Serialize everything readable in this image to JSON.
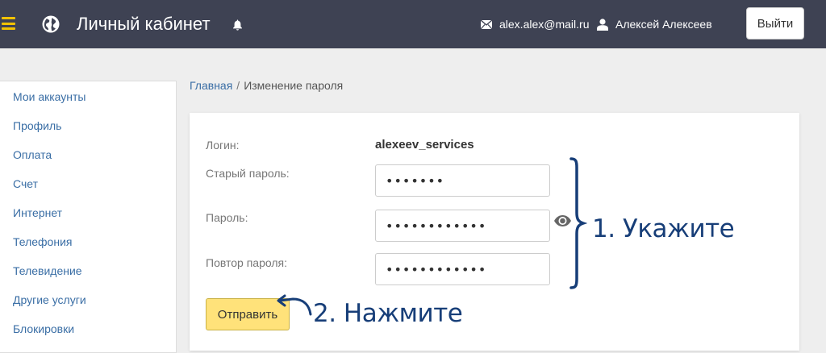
{
  "header": {
    "title": "Личный кабинет",
    "email": "alex.alex@mail.ru",
    "user_name": "Алексей Алексеев",
    "logout_label": "Выйти"
  },
  "sidebar": {
    "items": [
      {
        "label": "Мои аккаунты"
      },
      {
        "label": "Профиль"
      },
      {
        "label": "Оплата"
      },
      {
        "label": "Счет"
      },
      {
        "label": "Интернет"
      },
      {
        "label": "Телефония"
      },
      {
        "label": "Телевидение"
      },
      {
        "label": "Другие услуги"
      },
      {
        "label": "Блокировки"
      }
    ]
  },
  "breadcrumb": {
    "home": "Главная",
    "separator": "/",
    "current": "Изменение пароля"
  },
  "form": {
    "login_label": "Логин:",
    "login_value": "alexeev_services",
    "old_password_label": "Старый пароль:",
    "old_password_value": "•••••••",
    "password_label": "Пароль:",
    "password_value": "••••••••••••",
    "repeat_password_label": "Повтор пароля:",
    "repeat_password_value": "••••••••••••",
    "submit_label": "Отправить"
  },
  "annotations": {
    "step1": "1. Укажите",
    "step2": "2. Нажмите"
  },
  "colors": {
    "topbar": "#3e4253",
    "menu_icon": "#f2c200",
    "link": "#3a6ea5",
    "submit_button": "#ffe27a",
    "annotation": "#173e78"
  },
  "icons": [
    "menu-icon",
    "globe-icon",
    "bell-icon",
    "mail-icon",
    "user-icon",
    "eye-icon"
  ]
}
